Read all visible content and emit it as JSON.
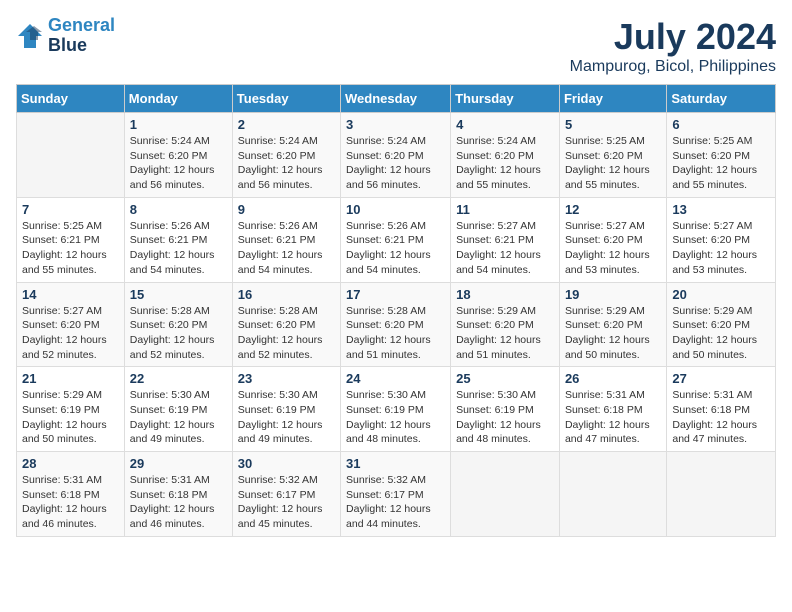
{
  "header": {
    "logo_line1": "General",
    "logo_line2": "Blue",
    "month_year": "July 2024",
    "location": "Mampurog, Bicol, Philippines"
  },
  "columns": [
    "Sunday",
    "Monday",
    "Tuesday",
    "Wednesday",
    "Thursday",
    "Friday",
    "Saturday"
  ],
  "weeks": [
    [
      {
        "day": "",
        "info": ""
      },
      {
        "day": "1",
        "info": "Sunrise: 5:24 AM\nSunset: 6:20 PM\nDaylight: 12 hours\nand 56 minutes."
      },
      {
        "day": "2",
        "info": "Sunrise: 5:24 AM\nSunset: 6:20 PM\nDaylight: 12 hours\nand 56 minutes."
      },
      {
        "day": "3",
        "info": "Sunrise: 5:24 AM\nSunset: 6:20 PM\nDaylight: 12 hours\nand 56 minutes."
      },
      {
        "day": "4",
        "info": "Sunrise: 5:24 AM\nSunset: 6:20 PM\nDaylight: 12 hours\nand 55 minutes."
      },
      {
        "day": "5",
        "info": "Sunrise: 5:25 AM\nSunset: 6:20 PM\nDaylight: 12 hours\nand 55 minutes."
      },
      {
        "day": "6",
        "info": "Sunrise: 5:25 AM\nSunset: 6:20 PM\nDaylight: 12 hours\nand 55 minutes."
      }
    ],
    [
      {
        "day": "7",
        "info": "Sunrise: 5:25 AM\nSunset: 6:21 PM\nDaylight: 12 hours\nand 55 minutes."
      },
      {
        "day": "8",
        "info": "Sunrise: 5:26 AM\nSunset: 6:21 PM\nDaylight: 12 hours\nand 54 minutes."
      },
      {
        "day": "9",
        "info": "Sunrise: 5:26 AM\nSunset: 6:21 PM\nDaylight: 12 hours\nand 54 minutes."
      },
      {
        "day": "10",
        "info": "Sunrise: 5:26 AM\nSunset: 6:21 PM\nDaylight: 12 hours\nand 54 minutes."
      },
      {
        "day": "11",
        "info": "Sunrise: 5:27 AM\nSunset: 6:21 PM\nDaylight: 12 hours\nand 54 minutes."
      },
      {
        "day": "12",
        "info": "Sunrise: 5:27 AM\nSunset: 6:20 PM\nDaylight: 12 hours\nand 53 minutes."
      },
      {
        "day": "13",
        "info": "Sunrise: 5:27 AM\nSunset: 6:20 PM\nDaylight: 12 hours\nand 53 minutes."
      }
    ],
    [
      {
        "day": "14",
        "info": "Sunrise: 5:27 AM\nSunset: 6:20 PM\nDaylight: 12 hours\nand 52 minutes."
      },
      {
        "day": "15",
        "info": "Sunrise: 5:28 AM\nSunset: 6:20 PM\nDaylight: 12 hours\nand 52 minutes."
      },
      {
        "day": "16",
        "info": "Sunrise: 5:28 AM\nSunset: 6:20 PM\nDaylight: 12 hours\nand 52 minutes."
      },
      {
        "day": "17",
        "info": "Sunrise: 5:28 AM\nSunset: 6:20 PM\nDaylight: 12 hours\nand 51 minutes."
      },
      {
        "day": "18",
        "info": "Sunrise: 5:29 AM\nSunset: 6:20 PM\nDaylight: 12 hours\nand 51 minutes."
      },
      {
        "day": "19",
        "info": "Sunrise: 5:29 AM\nSunset: 6:20 PM\nDaylight: 12 hours\nand 50 minutes."
      },
      {
        "day": "20",
        "info": "Sunrise: 5:29 AM\nSunset: 6:20 PM\nDaylight: 12 hours\nand 50 minutes."
      }
    ],
    [
      {
        "day": "21",
        "info": "Sunrise: 5:29 AM\nSunset: 6:19 PM\nDaylight: 12 hours\nand 50 minutes."
      },
      {
        "day": "22",
        "info": "Sunrise: 5:30 AM\nSunset: 6:19 PM\nDaylight: 12 hours\nand 49 minutes."
      },
      {
        "day": "23",
        "info": "Sunrise: 5:30 AM\nSunset: 6:19 PM\nDaylight: 12 hours\nand 49 minutes."
      },
      {
        "day": "24",
        "info": "Sunrise: 5:30 AM\nSunset: 6:19 PM\nDaylight: 12 hours\nand 48 minutes."
      },
      {
        "day": "25",
        "info": "Sunrise: 5:30 AM\nSunset: 6:19 PM\nDaylight: 12 hours\nand 48 minutes."
      },
      {
        "day": "26",
        "info": "Sunrise: 5:31 AM\nSunset: 6:18 PM\nDaylight: 12 hours\nand 47 minutes."
      },
      {
        "day": "27",
        "info": "Sunrise: 5:31 AM\nSunset: 6:18 PM\nDaylight: 12 hours\nand 47 minutes."
      }
    ],
    [
      {
        "day": "28",
        "info": "Sunrise: 5:31 AM\nSunset: 6:18 PM\nDaylight: 12 hours\nand 46 minutes."
      },
      {
        "day": "29",
        "info": "Sunrise: 5:31 AM\nSunset: 6:18 PM\nDaylight: 12 hours\nand 46 minutes."
      },
      {
        "day": "30",
        "info": "Sunrise: 5:32 AM\nSunset: 6:17 PM\nDaylight: 12 hours\nand 45 minutes."
      },
      {
        "day": "31",
        "info": "Sunrise: 5:32 AM\nSunset: 6:17 PM\nDaylight: 12 hours\nand 44 minutes."
      },
      {
        "day": "",
        "info": ""
      },
      {
        "day": "",
        "info": ""
      },
      {
        "day": "",
        "info": ""
      }
    ]
  ]
}
